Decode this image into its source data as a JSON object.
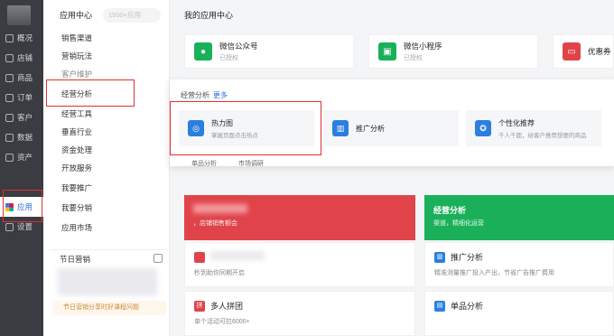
{
  "nav": {
    "items": [
      {
        "label": "概况",
        "icon": "monitor-icon"
      },
      {
        "label": "店铺",
        "icon": "shop-icon"
      },
      {
        "label": "商品",
        "icon": "bag-icon"
      },
      {
        "label": "订单",
        "icon": "order-icon"
      },
      {
        "label": "客户",
        "icon": "user-icon"
      },
      {
        "label": "数据",
        "icon": "chart-icon"
      },
      {
        "label": "资产",
        "icon": "wallet-icon"
      },
      {
        "label": "应用",
        "icon": "apps-icon"
      },
      {
        "label": "设置",
        "icon": "gear-icon"
      }
    ],
    "active_index": 7
  },
  "col": {
    "title": "应用中心",
    "search_placeholder": "1500+应用",
    "menu": [
      "销售渠道",
      "营销玩法",
      "客户维护",
      "经营分析",
      "经营工具",
      "垂直行业",
      "资金处理",
      "开放服务",
      "我要推广",
      "我要分销",
      "应用市场"
    ],
    "active_menu_index": 3
  },
  "festival": {
    "title": "节日营销",
    "note": "节日营销分享时好课程问题"
  },
  "main": {
    "title": "我的应用中心",
    "top_cards": [
      {
        "title": "微信公众号",
        "sub": "已授权",
        "color": "#1ab05a",
        "icon": "wechat-icon"
      },
      {
        "title": "微信小程序",
        "sub": "已授权",
        "color": "#1ab05a",
        "icon": "miniapp-icon"
      },
      {
        "title": "优惠券",
        "sub": "",
        "color": "#e0444a",
        "icon": "coupon-icon"
      }
    ],
    "panel": {
      "heading": "经营分析",
      "more": "更多",
      "cards": [
        {
          "title": "热力图",
          "sub": "掌握页面点击热点",
          "icon": "heatmap-icon"
        },
        {
          "title": "推广分析",
          "sub": "",
          "icon": "bar-chart-icon"
        },
        {
          "title": "个性化推荐",
          "sub": "千人千面，给客户推荐想要的商品",
          "icon": "recommend-icon"
        }
      ],
      "subtabs": [
        "单品分析",
        "市场调研"
      ]
    },
    "banners": [
      {
        "title": "",
        "sub": "，店铺销售额会",
        "color": "#e0444a"
      },
      {
        "title": "经营分析",
        "sub": "渠道，精细化运营",
        "color": "#1ab05a"
      }
    ],
    "blocks": [
      {
        "title": "",
        "sub": "秒到助你同期开启",
        "color": "#e0444a"
      },
      {
        "title": "推广分析",
        "sub": "精准测量推广投入产出，节省广告推广费用",
        "color": "#2b7fe0"
      },
      {
        "title": "多人拼团",
        "sub": "单个活动可拉6000+",
        "color": "#e0444a"
      },
      {
        "title": "单品分析",
        "sub": "",
        "color": "#2b7fe0"
      }
    ]
  }
}
